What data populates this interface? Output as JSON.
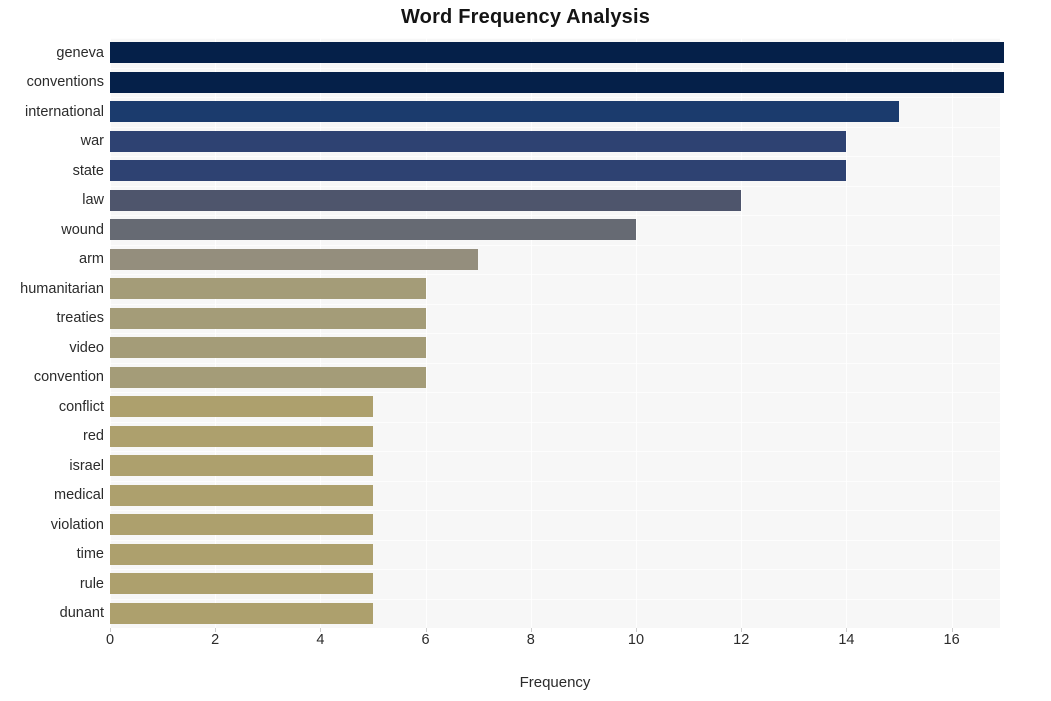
{
  "chart_data": {
    "type": "bar",
    "orientation": "horizontal",
    "title": "Word Frequency Analysis",
    "xlabel": "Frequency",
    "ylabel": "",
    "xlim": [
      0,
      16.92
    ],
    "xticks": [
      0,
      2,
      4,
      6,
      8,
      10,
      12,
      14,
      16
    ],
    "grid": true,
    "grid_axis": "both",
    "legend": false,
    "plot_background": "#f7f7f7",
    "figure_background": "#ffffff",
    "categories": [
      "geneva",
      "conventions",
      "international",
      "war",
      "state",
      "law",
      "wound",
      "arm",
      "humanitarian",
      "treaties",
      "video",
      "convention",
      "conflict",
      "red",
      "israel",
      "medical",
      "violation",
      "time",
      "rule",
      "dunant"
    ],
    "values": [
      17,
      17,
      15,
      14,
      14,
      12,
      10,
      7,
      6,
      6,
      6,
      6,
      5,
      5,
      5,
      5,
      5,
      5,
      5,
      5
    ],
    "bar_colors": [
      "#052049",
      "#052049",
      "#1b3b6d",
      "#2e4272",
      "#2e4272",
      "#4e556c",
      "#666a73",
      "#948e7d",
      "#a49c78",
      "#a49c78",
      "#a49c78",
      "#a49c78",
      "#ada06d",
      "#ada06d",
      "#ada06d",
      "#ada06d",
      "#ada06d",
      "#ada06d",
      "#ada06d",
      "#ada06d"
    ]
  }
}
